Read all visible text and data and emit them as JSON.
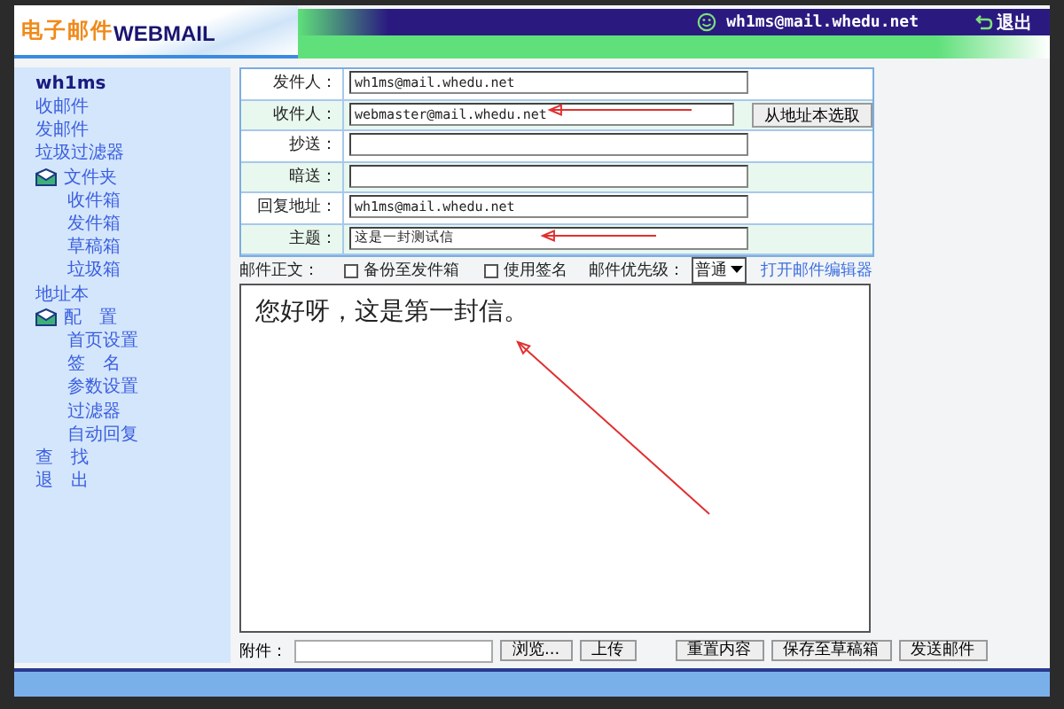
{
  "header": {
    "logo_cn": "电子邮件",
    "logo_en": "WEBMAIL",
    "user": "wh1ms@mail.whedu.net",
    "logout": "退出"
  },
  "sidebar": {
    "username": "wh1ms",
    "items": [
      {
        "kind": "link",
        "label": "收邮件"
      },
      {
        "kind": "link",
        "label": "发邮件"
      },
      {
        "kind": "link",
        "label": "垃圾过滤器"
      },
      {
        "kind": "folder",
        "label": "文件夹",
        "expanded": true,
        "children": [
          {
            "label": "收件箱"
          },
          {
            "label": "发件箱"
          },
          {
            "label": "草稿箱"
          },
          {
            "label": "垃圾箱"
          }
        ]
      },
      {
        "kind": "link",
        "label": "地址本"
      },
      {
        "kind": "folder",
        "label": "配　置",
        "expanded": true,
        "children": [
          {
            "label": "首页设置"
          },
          {
            "label": "签　名"
          },
          {
            "label": "参数设置"
          },
          {
            "label": "过滤器"
          },
          {
            "label": "自动回复"
          }
        ]
      },
      {
        "kind": "link",
        "label": "查　找"
      },
      {
        "kind": "link",
        "label": "退　出"
      }
    ]
  },
  "form": {
    "fields": [
      {
        "label": "发件人：",
        "value": "wh1ms@mail.whedu.net"
      },
      {
        "label": "收件人：",
        "value": "webmaster@mail.whedu.net",
        "button": "从地址本选取"
      },
      {
        "label": "抄送："
      },
      {
        "label": "暗送："
      },
      {
        "label": "回复地址：",
        "value": "wh1ms@mail.whedu.net"
      },
      {
        "label": "主题：",
        "value": "这是一封测试信"
      }
    ],
    "body_label": "邮件正文：",
    "checkboxes": [
      {
        "label": "备份至发件箱",
        "checked": false
      },
      {
        "label": "使用签名",
        "checked": false
      }
    ],
    "priority_label": "邮件优先级：",
    "priority": "普通",
    "editor_link": "打开邮件编辑器",
    "body_text": "您好呀，这是第一封信。",
    "attachment_label": "附件：",
    "buttons": [
      "浏览...",
      "上传",
      "重置内容",
      "保存至草稿箱",
      "发送邮件"
    ]
  }
}
